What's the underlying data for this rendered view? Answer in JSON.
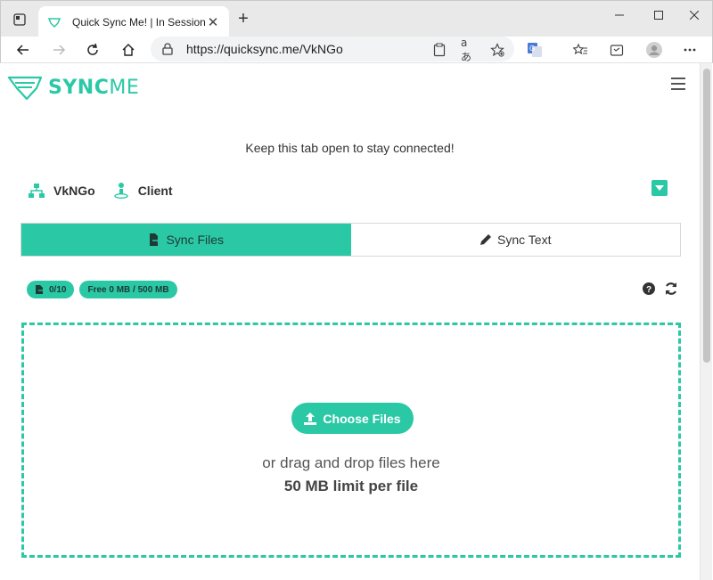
{
  "browser": {
    "tab_title": "Quick Sync Me! | In Session",
    "url_host": "https://quicksync.me",
    "url_path": "/VkNGo"
  },
  "header": {
    "logo_bold": "SYNC",
    "logo_rest": "ME"
  },
  "session": {
    "notice": "Keep this tab open to stay connected!",
    "session_id": "VkNGo",
    "role": "Client"
  },
  "tabs": [
    {
      "label": "Sync Files",
      "active": true
    },
    {
      "label": "Sync Text",
      "active": false
    }
  ],
  "stats": {
    "files_count": "0/10",
    "storage": "Free 0 MB / 500 MB"
  },
  "dropzone": {
    "button_label": "Choose Files",
    "drag_text": "or drag and drop files here",
    "limit_text": "50 MB limit per file"
  },
  "colors": {
    "accent": "#2bc8a6",
    "accent_text": "#1d3a34"
  }
}
